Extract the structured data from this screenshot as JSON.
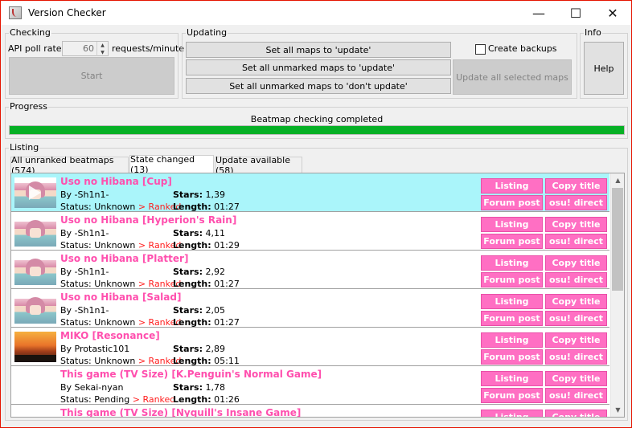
{
  "window": {
    "title": "Version Checker",
    "minimize_glyph": "—",
    "maximize_glyph": "☐",
    "close_glyph": "✕"
  },
  "checking": {
    "label": "Checking",
    "poll_label": "API poll rate:",
    "poll_value": "60",
    "poll_unit": "requests/minute",
    "start_label": "Start"
  },
  "updating": {
    "label": "Updating",
    "set_all_update": "Set all maps to 'update'",
    "set_unmarked_update": "Set all unmarked maps to 'update'",
    "set_unmarked_dont": "Set all unmarked maps to 'don't update'",
    "create_backups_label": "Create backups",
    "create_backups_checked": false,
    "update_selected": "Update all selected maps"
  },
  "info": {
    "label": "Info",
    "help_label": "Help"
  },
  "progress": {
    "label": "Progress",
    "status_text": "Beatmap checking completed",
    "fraction": 1.0,
    "fill_color": "#06b025"
  },
  "listing": {
    "label": "Listing",
    "tabs": [
      {
        "label": "All unranked beatmaps (574)",
        "active": false
      },
      {
        "label": "State changed (13)",
        "active": true
      },
      {
        "label": "Update available (58)",
        "active": false
      }
    ],
    "button_labels": {
      "listing": "Listing",
      "copy_title": "Copy title",
      "forum_post": "Forum post",
      "osu_direct": "osu! direct"
    },
    "stars_label": "Stars:",
    "length_label": "Length:",
    "accent_color": "#ff6fc3",
    "rows": [
      {
        "title": "Uso no Hibana [Cup]",
        "by": "By -Sh1n1-",
        "status_prefix": "Status: Unknown",
        "status_change": " > Ranked",
        "stars": "1,39",
        "length": "01:27",
        "thumb": "anime-girl-thumbnail",
        "selected": true
      },
      {
        "title": "Uso no Hibana [Hyperion's Rain]",
        "by": "By -Sh1n1-",
        "status_prefix": "Status: Unknown",
        "status_change": " > Ranked",
        "stars": "4,11",
        "length": "01:29",
        "thumb": "anime-girl-thumbnail",
        "selected": false
      },
      {
        "title": "Uso no Hibana [Platter]",
        "by": "By -Sh1n1-",
        "status_prefix": "Status: Unknown",
        "status_change": " > Ranked",
        "stars": "2,92",
        "length": "01:27",
        "thumb": "anime-girl-thumbnail",
        "selected": false
      },
      {
        "title": "Uso no Hibana [Salad]",
        "by": "By -Sh1n1-",
        "status_prefix": "Status: Unknown",
        "status_change": " > Ranked",
        "stars": "2,05",
        "length": "01:27",
        "thumb": "anime-girl-thumbnail",
        "selected": false
      },
      {
        "title": "MIKO [Resonance]",
        "by": "By Protastic101",
        "status_prefix": "Status: Unknown",
        "status_change": " > Ranked",
        "stars": "2,89",
        "length": "05:11",
        "thumb": "sunset-thumbnail",
        "selected": false
      },
      {
        "title": "This game (TV Size) [K.Penguin's Normal Game]",
        "by": "By Sekai-nyan",
        "status_prefix": "Status: Pending",
        "status_change": " > Ranked",
        "stars": "1,78",
        "length": "01:26",
        "thumb": "",
        "selected": false
      },
      {
        "title": "This game (TV Size) [Nyquill's Insane Game]",
        "by": "",
        "status_prefix": "",
        "status_change": "",
        "stars": "",
        "length": "",
        "thumb": "",
        "selected": false
      }
    ]
  }
}
